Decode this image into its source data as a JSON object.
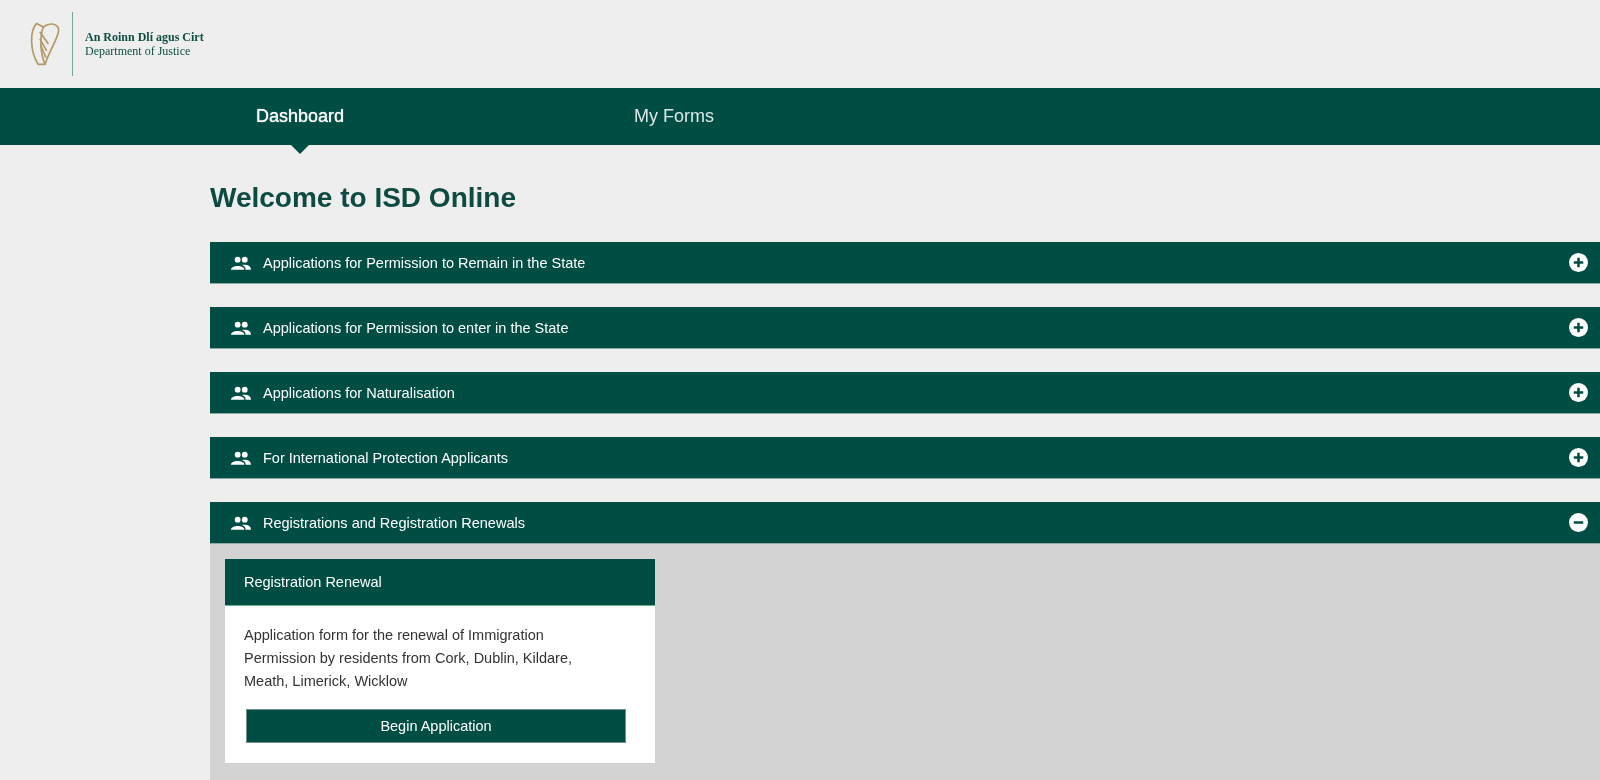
{
  "logo": {
    "line_1": "An Roinn Dlí agus Cirt",
    "line_2": "Department of Justice"
  },
  "nav": [
    {
      "label": "Dashboard",
      "selected": true
    },
    {
      "label": "My Forms",
      "selected": false
    }
  ],
  "title": "Welcome to ISD Online",
  "sections": [
    {
      "label": "Applications for Permission to Remain in the State",
      "expanded": false
    },
    {
      "label": "Applications for Permission to enter in the State",
      "expanded": false
    },
    {
      "label": "Applications for Naturalisation",
      "expanded": false
    },
    {
      "label": "For International Protection Applicants",
      "expanded": false
    },
    {
      "label": "Registrations and Registration Renewals",
      "expanded": true,
      "cards": [
        {
          "title": "Registration Renewal",
          "description": "Application form for the renewal of Immigration Permission by residents from Cork, Dublin, Kildare, Meath, Limerick, Wicklow",
          "button": "Begin Application"
        }
      ]
    }
  ]
}
